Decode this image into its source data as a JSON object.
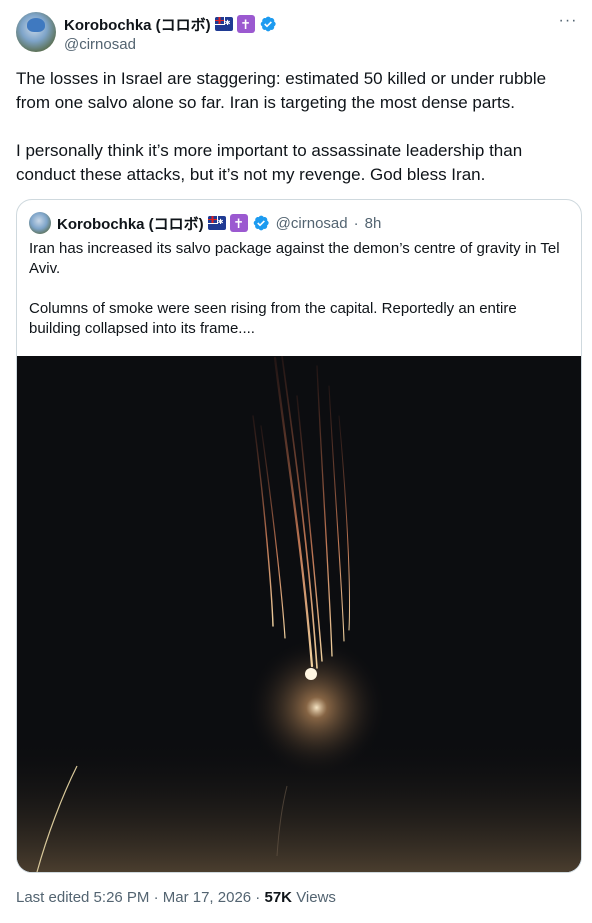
{
  "author": {
    "display_name": "Korobochka (コロボ)",
    "handle": "@cirnosad"
  },
  "tweet": {
    "text": "The losses in Israel are staggering: estimated 50 killed or under rubble from one salvo alone so far. Iran is targeting the most dense parts.\n\nI personally think it’s more important to assassinate leadership than conduct these attacks, but it’s not my revenge. God bless Iran."
  },
  "quoted_tweet": {
    "display_name": "Korobochka (コロボ)",
    "handle": "@cirnosad",
    "separator": "·",
    "time": "8h",
    "text": "Iran has increased its salvo package against the demon’s centre of gravity in Tel Aviv.\n\nColumns of smoke were seen rising from the capital. Reportedly an entire building collapsed into its frame...."
  },
  "footer": {
    "edited": "Last edited 5:26 PM · Mar 17, 2026 ·",
    "views_count": "57K",
    "views_label": "Views"
  },
  "icons": {
    "flag": "australia-flag-icon",
    "cross": "latin-cross-icon",
    "verified": "verified-badge-icon",
    "more": "more-options-icon"
  },
  "colors": {
    "verified": "#1d9bf0",
    "cross_bg": "#9b59d0",
    "muted_text": "#536471",
    "border": "#cfd9de"
  },
  "glyphs": {
    "more": "···",
    "cross": "✝"
  }
}
